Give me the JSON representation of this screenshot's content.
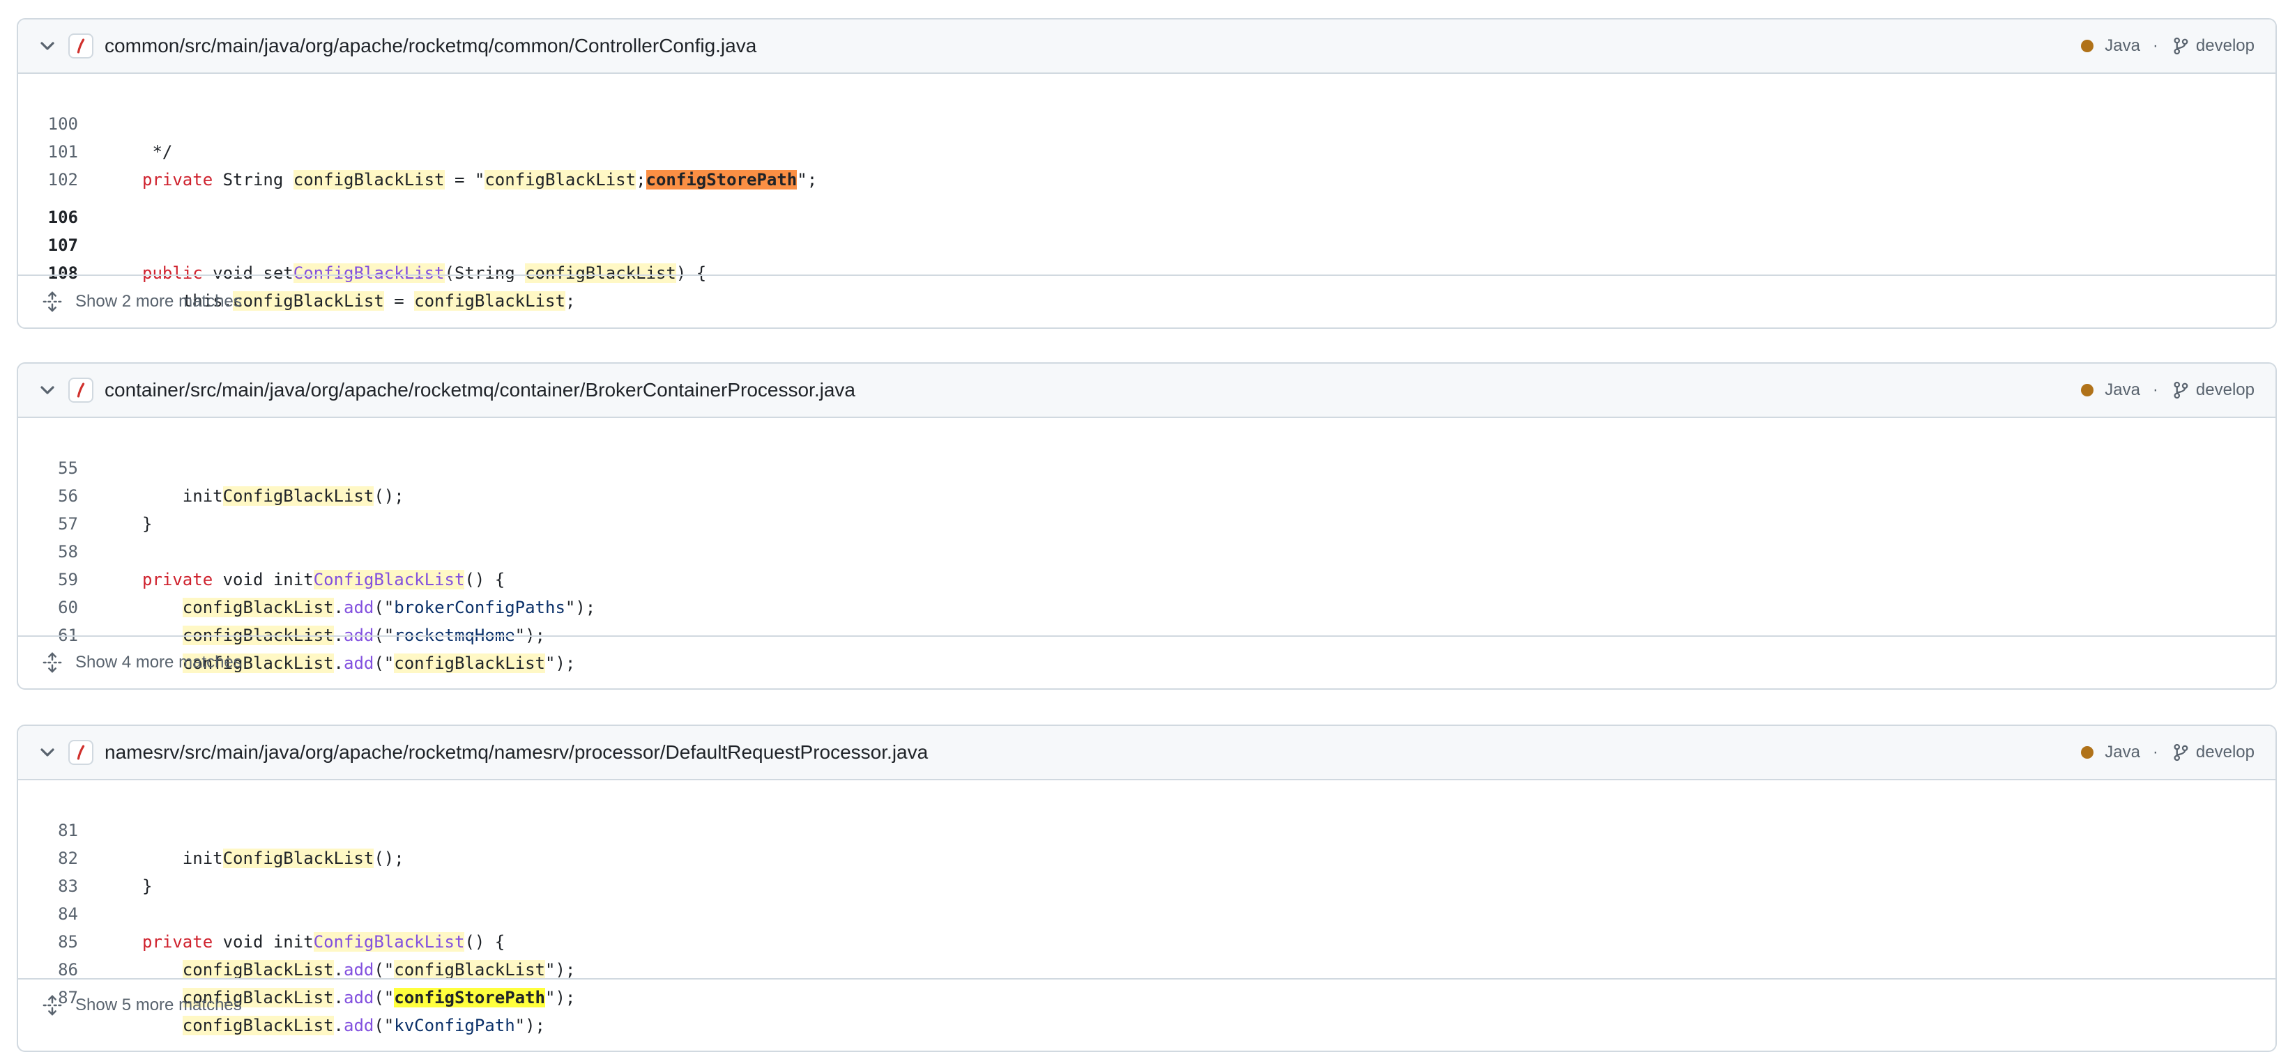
{
  "results": [
    {
      "path": "common/src/main/java/org/apache/rocketmq/common/ControllerConfig.java",
      "language": "Java",
      "language_color": "#b07219",
      "separator": "·",
      "branch": "develop",
      "more_matches": "Show 2 more matches",
      "line_numbers": [
        "100",
        "101",
        "102",
        "106",
        "107",
        "108"
      ]
    },
    {
      "path": "container/src/main/java/org/apache/rocketmq/container/BrokerContainerProcessor.java",
      "language": "Java",
      "language_color": "#b07219",
      "separator": "·",
      "branch": "develop",
      "more_matches": "Show 4 more matches",
      "line_numbers": [
        "55",
        "56",
        "57",
        "58",
        "59",
        "60",
        "61"
      ]
    },
    {
      "path": "namesrv/src/main/java/org/apache/rocketmq/namesrv/processor/DefaultRequestProcessor.java",
      "language": "Java",
      "language_color": "#b07219",
      "separator": "·",
      "branch": "develop",
      "more_matches": "Show 5 more matches",
      "line_numbers": [
        "81",
        "82",
        "83",
        "84",
        "85",
        "86",
        "87"
      ]
    }
  ],
  "tokens": {
    "comment_end": " */",
    "private": "private",
    "public": "public",
    "void": "void",
    "string": "String",
    "config_black_list": "configBlackList",
    "Config_Black_List": "ConfigBlackList",
    "config_store_path": "configStorePath",
    "eq_quote": " = \"",
    "semi": ";",
    "quote_semi": "\";",
    "set": "set",
    "init": "init",
    "open_string": "(String ",
    "close_brace_open": ") {",
    "this_dot": "this.",
    "assign": " = ",
    "call_end": "();",
    "close_brace": "}",
    "decl_end": "() {",
    "dot": ".",
    "add": "add",
    "open_quote": "(\"",
    "close_call": "\");",
    "broker_config_paths": "brokerConfigPaths",
    "rocketmq_home": "rocketmqHome",
    "kv_config_path": "kvConfigPath"
  }
}
